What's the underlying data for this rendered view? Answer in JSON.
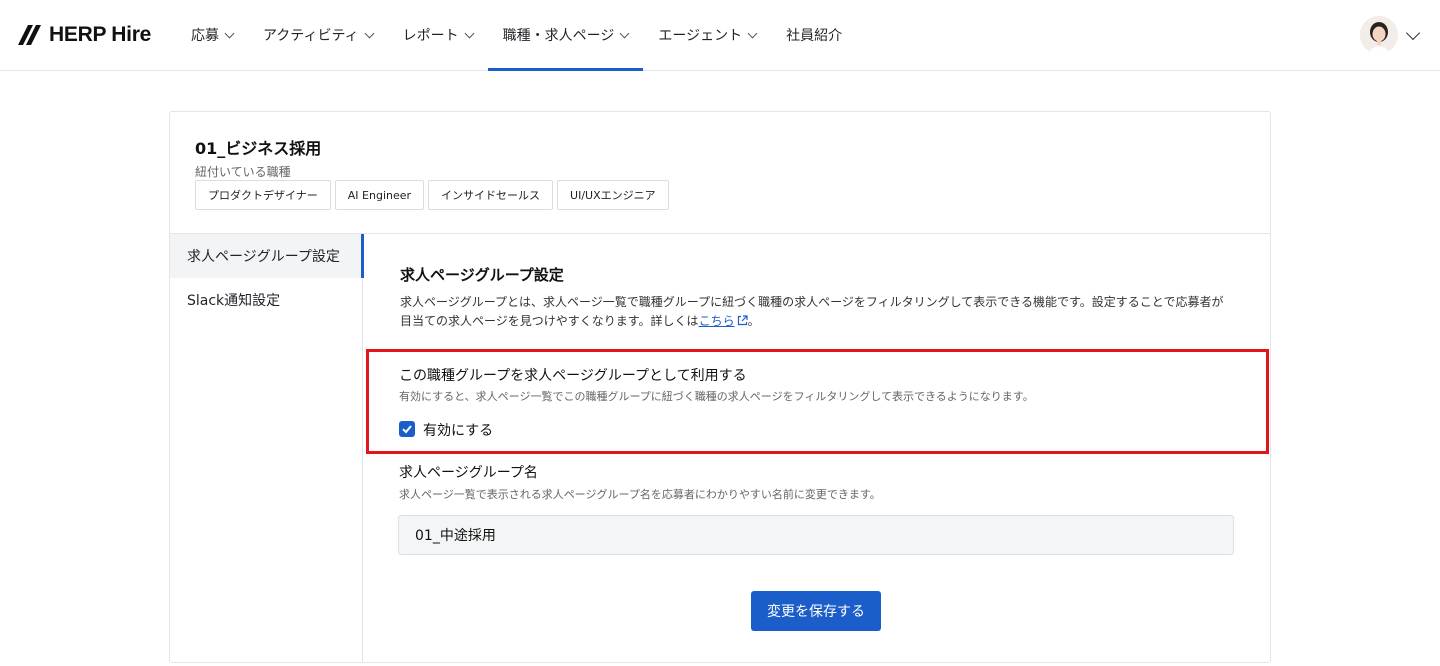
{
  "header": {
    "logo_text": "HERP Hire",
    "nav": [
      {
        "label": "応募",
        "has_dropdown": true
      },
      {
        "label": "アクティビティ",
        "has_dropdown": true
      },
      {
        "label": "レポート",
        "has_dropdown": true
      },
      {
        "label": "職種・求人ページ",
        "has_dropdown": true,
        "active": true
      },
      {
        "label": "エージェント",
        "has_dropdown": true
      },
      {
        "label": "社員紹介",
        "has_dropdown": false
      }
    ]
  },
  "group": {
    "title": "01_ビジネス採用",
    "linked_label": "紐付いている職種",
    "chips": [
      "プロダクトデザイナー",
      "AI Engineer",
      "インサイドセールス",
      "UI/UXエンジニア"
    ]
  },
  "sidebar": {
    "items": [
      {
        "label": "求人ページグループ設定",
        "active": true
      },
      {
        "label": "Slack通知設定",
        "active": false
      }
    ]
  },
  "content": {
    "title": "求人ページグループ設定",
    "desc_line1": "求人ページグループとは、求人ページ一覧で職種グループに紐づく職種の求人ページをフィルタリングして表示できる機能です。設定することで応募者が",
    "desc_line2_prefix": "目当ての求人ページを見つけやすくなります。詳しくは",
    "desc_link": "こちら",
    "desc_suffix": "。",
    "option": {
      "title": "この職種グループを求人ページグループとして利用する",
      "desc": "有効にすると、求人ページ一覧でこの職種グループに紐づく職種の求人ページをフィルタリングして表示できるようになります。",
      "checkbox_label": "有効にする",
      "checked": true
    },
    "name_field": {
      "title": "求人ページグループ名",
      "desc": "求人ページ一覧で表示される求人ページグループ名を応募者にわかりやすい名前に変更できます。",
      "value": "01_中途採用"
    },
    "save_label": "変更を保存する"
  },
  "colors": {
    "accent": "#1b5ec9",
    "highlight": "#e0161b"
  }
}
